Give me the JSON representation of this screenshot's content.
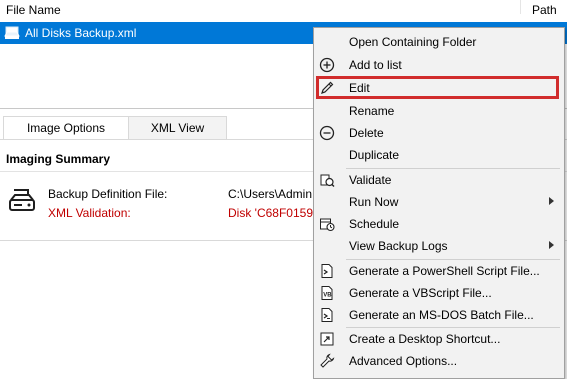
{
  "list": {
    "col_file_name": "File Name",
    "col_path": "Path",
    "row_name": "All Disks Backup.xml"
  },
  "tabs": [
    {
      "label": "Image Options"
    },
    {
      "label": "XML View"
    }
  ],
  "summary": {
    "title": "Imaging Summary",
    "backup_def_label": "Backup Definition File:",
    "backup_def_value": "C:\\Users\\Admin",
    "xml_label": "XML Validation:",
    "xml_value": "Disk 'C68F0159-"
  },
  "context_menu": {
    "items": [
      {
        "label": "Open Containing Folder",
        "icon": "folder-icon"
      },
      {
        "label": "Add to list",
        "icon": "plus-circle-icon"
      },
      {
        "label": "Edit",
        "icon": "pencil-icon"
      },
      {
        "label": "Rename",
        "icon": ""
      },
      {
        "label": "Delete",
        "icon": "minus-circle-icon"
      },
      {
        "label": "Duplicate",
        "icon": ""
      },
      {
        "label": "Validate",
        "icon": "validate-icon"
      },
      {
        "label": "Run Now",
        "icon": ""
      },
      {
        "label": "Schedule",
        "icon": "schedule-icon"
      },
      {
        "label": "View Backup Logs",
        "icon": ""
      },
      {
        "label": "Generate a PowerShell Script File...",
        "icon": "powershell-script-icon"
      },
      {
        "label": "Generate a VBScript File...",
        "icon": "vbscript-icon"
      },
      {
        "label": "Generate an MS-DOS Batch File...",
        "icon": "batch-file-icon"
      },
      {
        "label": "Create a Desktop Shortcut...",
        "icon": "shortcut-icon"
      },
      {
        "label": "Advanced Options...",
        "icon": "wrench-icon"
      }
    ]
  },
  "colors": {
    "selection": "#0078d7",
    "error_text": "#c00000",
    "highlight_border": "#d12c2c",
    "menu_bg": "#f2f2f2"
  }
}
